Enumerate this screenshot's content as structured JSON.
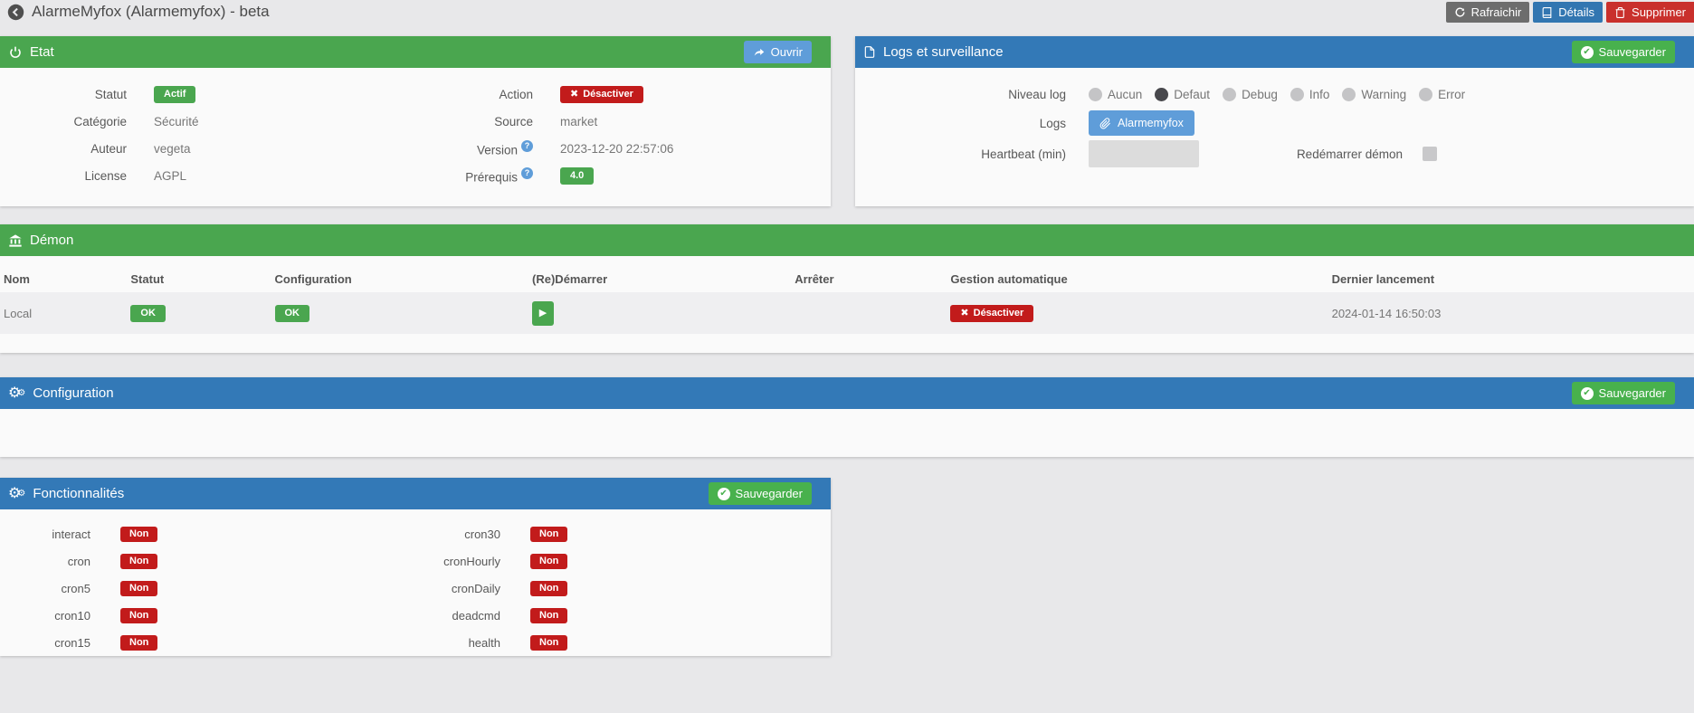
{
  "icons": {
    "cross": "✖",
    "check": "✔",
    "play": "▶",
    "gears": "⚙",
    "help": "?"
  },
  "topbar": {
    "title": "AlarmeMyfox (Alarmemyfox) - beta",
    "refresh_label": "Rafraichir",
    "details_label": "Détails",
    "delete_label": "Supprimer"
  },
  "etat": {
    "title": "Etat",
    "open_label": "Ouvrir",
    "statut_label": "Statut",
    "statut_value": "Actif",
    "categorie_label": "Catégorie",
    "categorie_value": "Sécurité",
    "auteur_label": "Auteur",
    "auteur_value": "vegeta",
    "license_label": "License",
    "license_value": "AGPL",
    "action_label": "Action",
    "action_value": "Désactiver",
    "source_label": "Source",
    "source_value": "market",
    "version_label": "Version",
    "version_value": "2023-12-20 22:57:06",
    "prerequis_label": "Prérequis",
    "prerequis_value": "4.0"
  },
  "logs": {
    "title": "Logs et surveillance",
    "save_label": "Sauvegarder",
    "niveau_label": "Niveau log",
    "levels": [
      {
        "label": "Aucun",
        "selected": false
      },
      {
        "label": "Defaut",
        "selected": true
      },
      {
        "label": "Debug",
        "selected": false
      },
      {
        "label": "Info",
        "selected": false
      },
      {
        "label": "Warning",
        "selected": false
      },
      {
        "label": "Error",
        "selected": false
      }
    ],
    "logs_label": "Logs",
    "logfile_label": "Alarmemyfox",
    "heartbeat_label": "Heartbeat (min)",
    "heartbeat_value": "",
    "restart_label": "Redémarrer démon"
  },
  "demon": {
    "title": "Démon",
    "columns": [
      "Nom",
      "Statut",
      "Configuration",
      "(Re)Démarrer",
      "Arrêter",
      "Gestion automatique",
      "Dernier lancement"
    ],
    "row": {
      "nom": "Local",
      "statut": "OK",
      "configuration": "OK",
      "gestion_label": "Désactiver",
      "dernier_lancement": "2024-01-14 16:50:03"
    }
  },
  "configuration": {
    "title": "Configuration",
    "save_label": "Sauvegarder"
  },
  "fonctionnalites": {
    "title": "Fonctionnalités",
    "save_label": "Sauvegarder",
    "items": [
      {
        "label": "interact",
        "value": "Non"
      },
      {
        "label": "cron",
        "value": "Non"
      },
      {
        "label": "cron5",
        "value": "Non"
      },
      {
        "label": "cron10",
        "value": "Non"
      },
      {
        "label": "cron15",
        "value": "Non"
      },
      {
        "label": "cron30",
        "value": "Non"
      },
      {
        "label": "cronHourly",
        "value": "Non"
      },
      {
        "label": "cronDaily",
        "value": "Non"
      },
      {
        "label": "deadcmd",
        "value": "Non"
      },
      {
        "label": "health",
        "value": "Non"
      }
    ]
  }
}
